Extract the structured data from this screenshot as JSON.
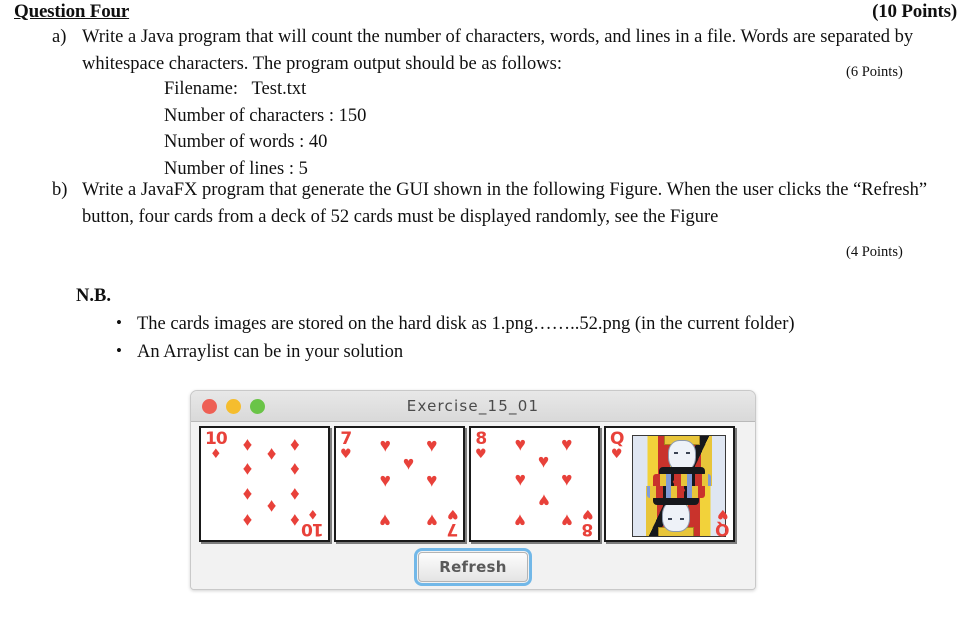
{
  "question": {
    "title": "Question Four",
    "total_points": "(10 Points)",
    "items": [
      {
        "marker": "a)",
        "text": "Write a Java program that will count the number of characters, words, and lines in a file. Words are separated by whitespace characters. The program output should be as follows:",
        "points": "(6 Points)"
      },
      {
        "marker": "b)",
        "text": "Write a JavaFX program that generate the GUI shown in the following Figure. When the user clicks the “Refresh” button, four cards from a deck of 52 cards must be displayed randomly, see the Figure",
        "points": "(4 Points)"
      }
    ],
    "sample_output": [
      "Filename:   Test.txt",
      "Number of characters : 150",
      "Number of words : 40",
      "Number of lines : 5"
    ],
    "nb_heading": "N.B.",
    "nb_items": [
      "The cards images are stored on the hard disk as 1.png……..52.png (in the current folder)",
      "An Arraylist can be in your solution"
    ]
  },
  "app_window": {
    "title": "Exercise_15_01",
    "traffic_lights": [
      {
        "name": "close",
        "color": "#ee6055"
      },
      {
        "name": "minimize",
        "color": "#f5bd2e"
      },
      {
        "name": "maximize",
        "color": "#6ac447"
      }
    ],
    "suit_red": "#e8413a",
    "cards": [
      {
        "rank": "10",
        "suit": "diamonds",
        "pip": "♦",
        "type": "number",
        "count": 10
      },
      {
        "rank": "7",
        "suit": "hearts",
        "pip": "♥",
        "type": "number",
        "count": 7
      },
      {
        "rank": "8",
        "suit": "hearts",
        "pip": "♥",
        "type": "number",
        "count": 8
      },
      {
        "rank": "Q",
        "suit": "hearts",
        "pip": "♥",
        "type": "face",
        "count": 0
      }
    ],
    "refresh_label": "Refresh"
  }
}
